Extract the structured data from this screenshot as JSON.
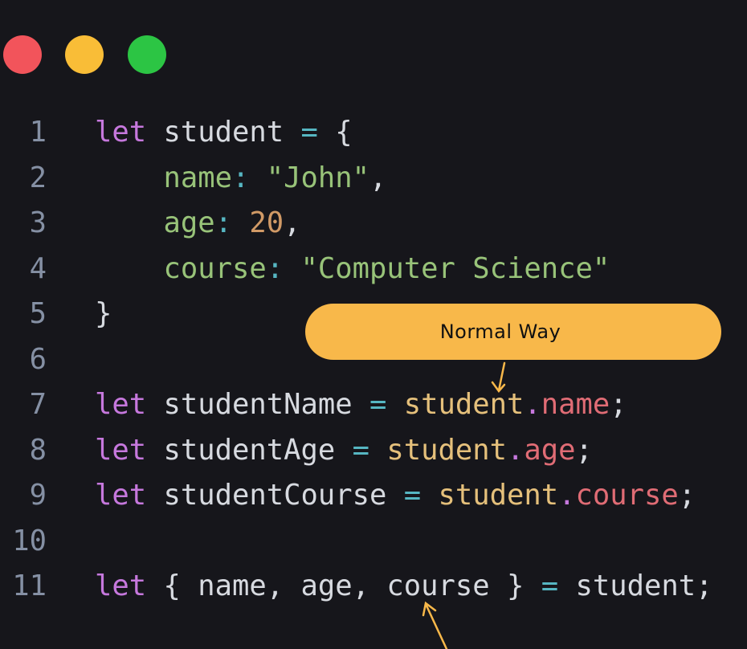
{
  "window_controls": {
    "close_color": "#f2545b",
    "minimize_color": "#f9bd37",
    "maximize_color": "#2cc544"
  },
  "colors": {
    "background": "#16161b",
    "keyword": "#c678dd",
    "plain": "#d7dae0",
    "operator": "#56b6c2",
    "property": "#98c379",
    "string": "#98c379",
    "number": "#d19a66",
    "object": "#e5c07b",
    "member": "#e06c75",
    "dot": "#c678dd",
    "line_number": "#8590a4",
    "annotation": "#f8b84a"
  },
  "annotation": {
    "label": "Normal Way"
  },
  "code": {
    "lines": [
      {
        "number": "1",
        "tokens": [
          {
            "text": "let",
            "kind": "keyword"
          },
          {
            "text": " student ",
            "kind": "plain"
          },
          {
            "text": "=",
            "kind": "operator"
          },
          {
            "text": " {",
            "kind": "plain"
          }
        ]
      },
      {
        "number": "2",
        "tokens": [
          {
            "text": "    name",
            "kind": "property"
          },
          {
            "text": ":",
            "kind": "operator"
          },
          {
            "text": " \"John\"",
            "kind": "string"
          },
          {
            "text": ",",
            "kind": "plain"
          }
        ]
      },
      {
        "number": "3",
        "tokens": [
          {
            "text": "    age",
            "kind": "property"
          },
          {
            "text": ":",
            "kind": "operator"
          },
          {
            "text": " ",
            "kind": "plain"
          },
          {
            "text": "20",
            "kind": "number"
          },
          {
            "text": ",",
            "kind": "plain"
          }
        ]
      },
      {
        "number": "4",
        "tokens": [
          {
            "text": "    course",
            "kind": "property"
          },
          {
            "text": ":",
            "kind": "operator"
          },
          {
            "text": " \"Computer Science\"",
            "kind": "string"
          }
        ]
      },
      {
        "number": "5",
        "tokens": [
          {
            "text": "}",
            "kind": "plain"
          }
        ]
      },
      {
        "number": "6",
        "tokens": []
      },
      {
        "number": "7",
        "tokens": [
          {
            "text": "let",
            "kind": "keyword"
          },
          {
            "text": " studentName ",
            "kind": "plain"
          },
          {
            "text": "=",
            "kind": "operator"
          },
          {
            "text": " ",
            "kind": "plain"
          },
          {
            "text": "student",
            "kind": "object"
          },
          {
            "text": ".",
            "kind": "dot"
          },
          {
            "text": "name",
            "kind": "member"
          },
          {
            "text": ";",
            "kind": "plain"
          }
        ]
      },
      {
        "number": "8",
        "tokens": [
          {
            "text": "let",
            "kind": "keyword"
          },
          {
            "text": " studentAge ",
            "kind": "plain"
          },
          {
            "text": "=",
            "kind": "operator"
          },
          {
            "text": " ",
            "kind": "plain"
          },
          {
            "text": "student",
            "kind": "object"
          },
          {
            "text": ".",
            "kind": "dot"
          },
          {
            "text": "age",
            "kind": "member"
          },
          {
            "text": ";",
            "kind": "plain"
          }
        ]
      },
      {
        "number": "9",
        "tokens": [
          {
            "text": "let",
            "kind": "keyword"
          },
          {
            "text": " studentCourse ",
            "kind": "plain"
          },
          {
            "text": "=",
            "kind": "operator"
          },
          {
            "text": " ",
            "kind": "plain"
          },
          {
            "text": "student",
            "kind": "object"
          },
          {
            "text": ".",
            "kind": "dot"
          },
          {
            "text": "course",
            "kind": "member"
          },
          {
            "text": ";",
            "kind": "plain"
          }
        ]
      },
      {
        "number": "10",
        "tokens": []
      },
      {
        "number": "11",
        "tokens": [
          {
            "text": "let",
            "kind": "keyword"
          },
          {
            "text": " { name, age, course } ",
            "kind": "plain"
          },
          {
            "text": "=",
            "kind": "operator"
          },
          {
            "text": " student;",
            "kind": "plain"
          }
        ]
      }
    ]
  }
}
